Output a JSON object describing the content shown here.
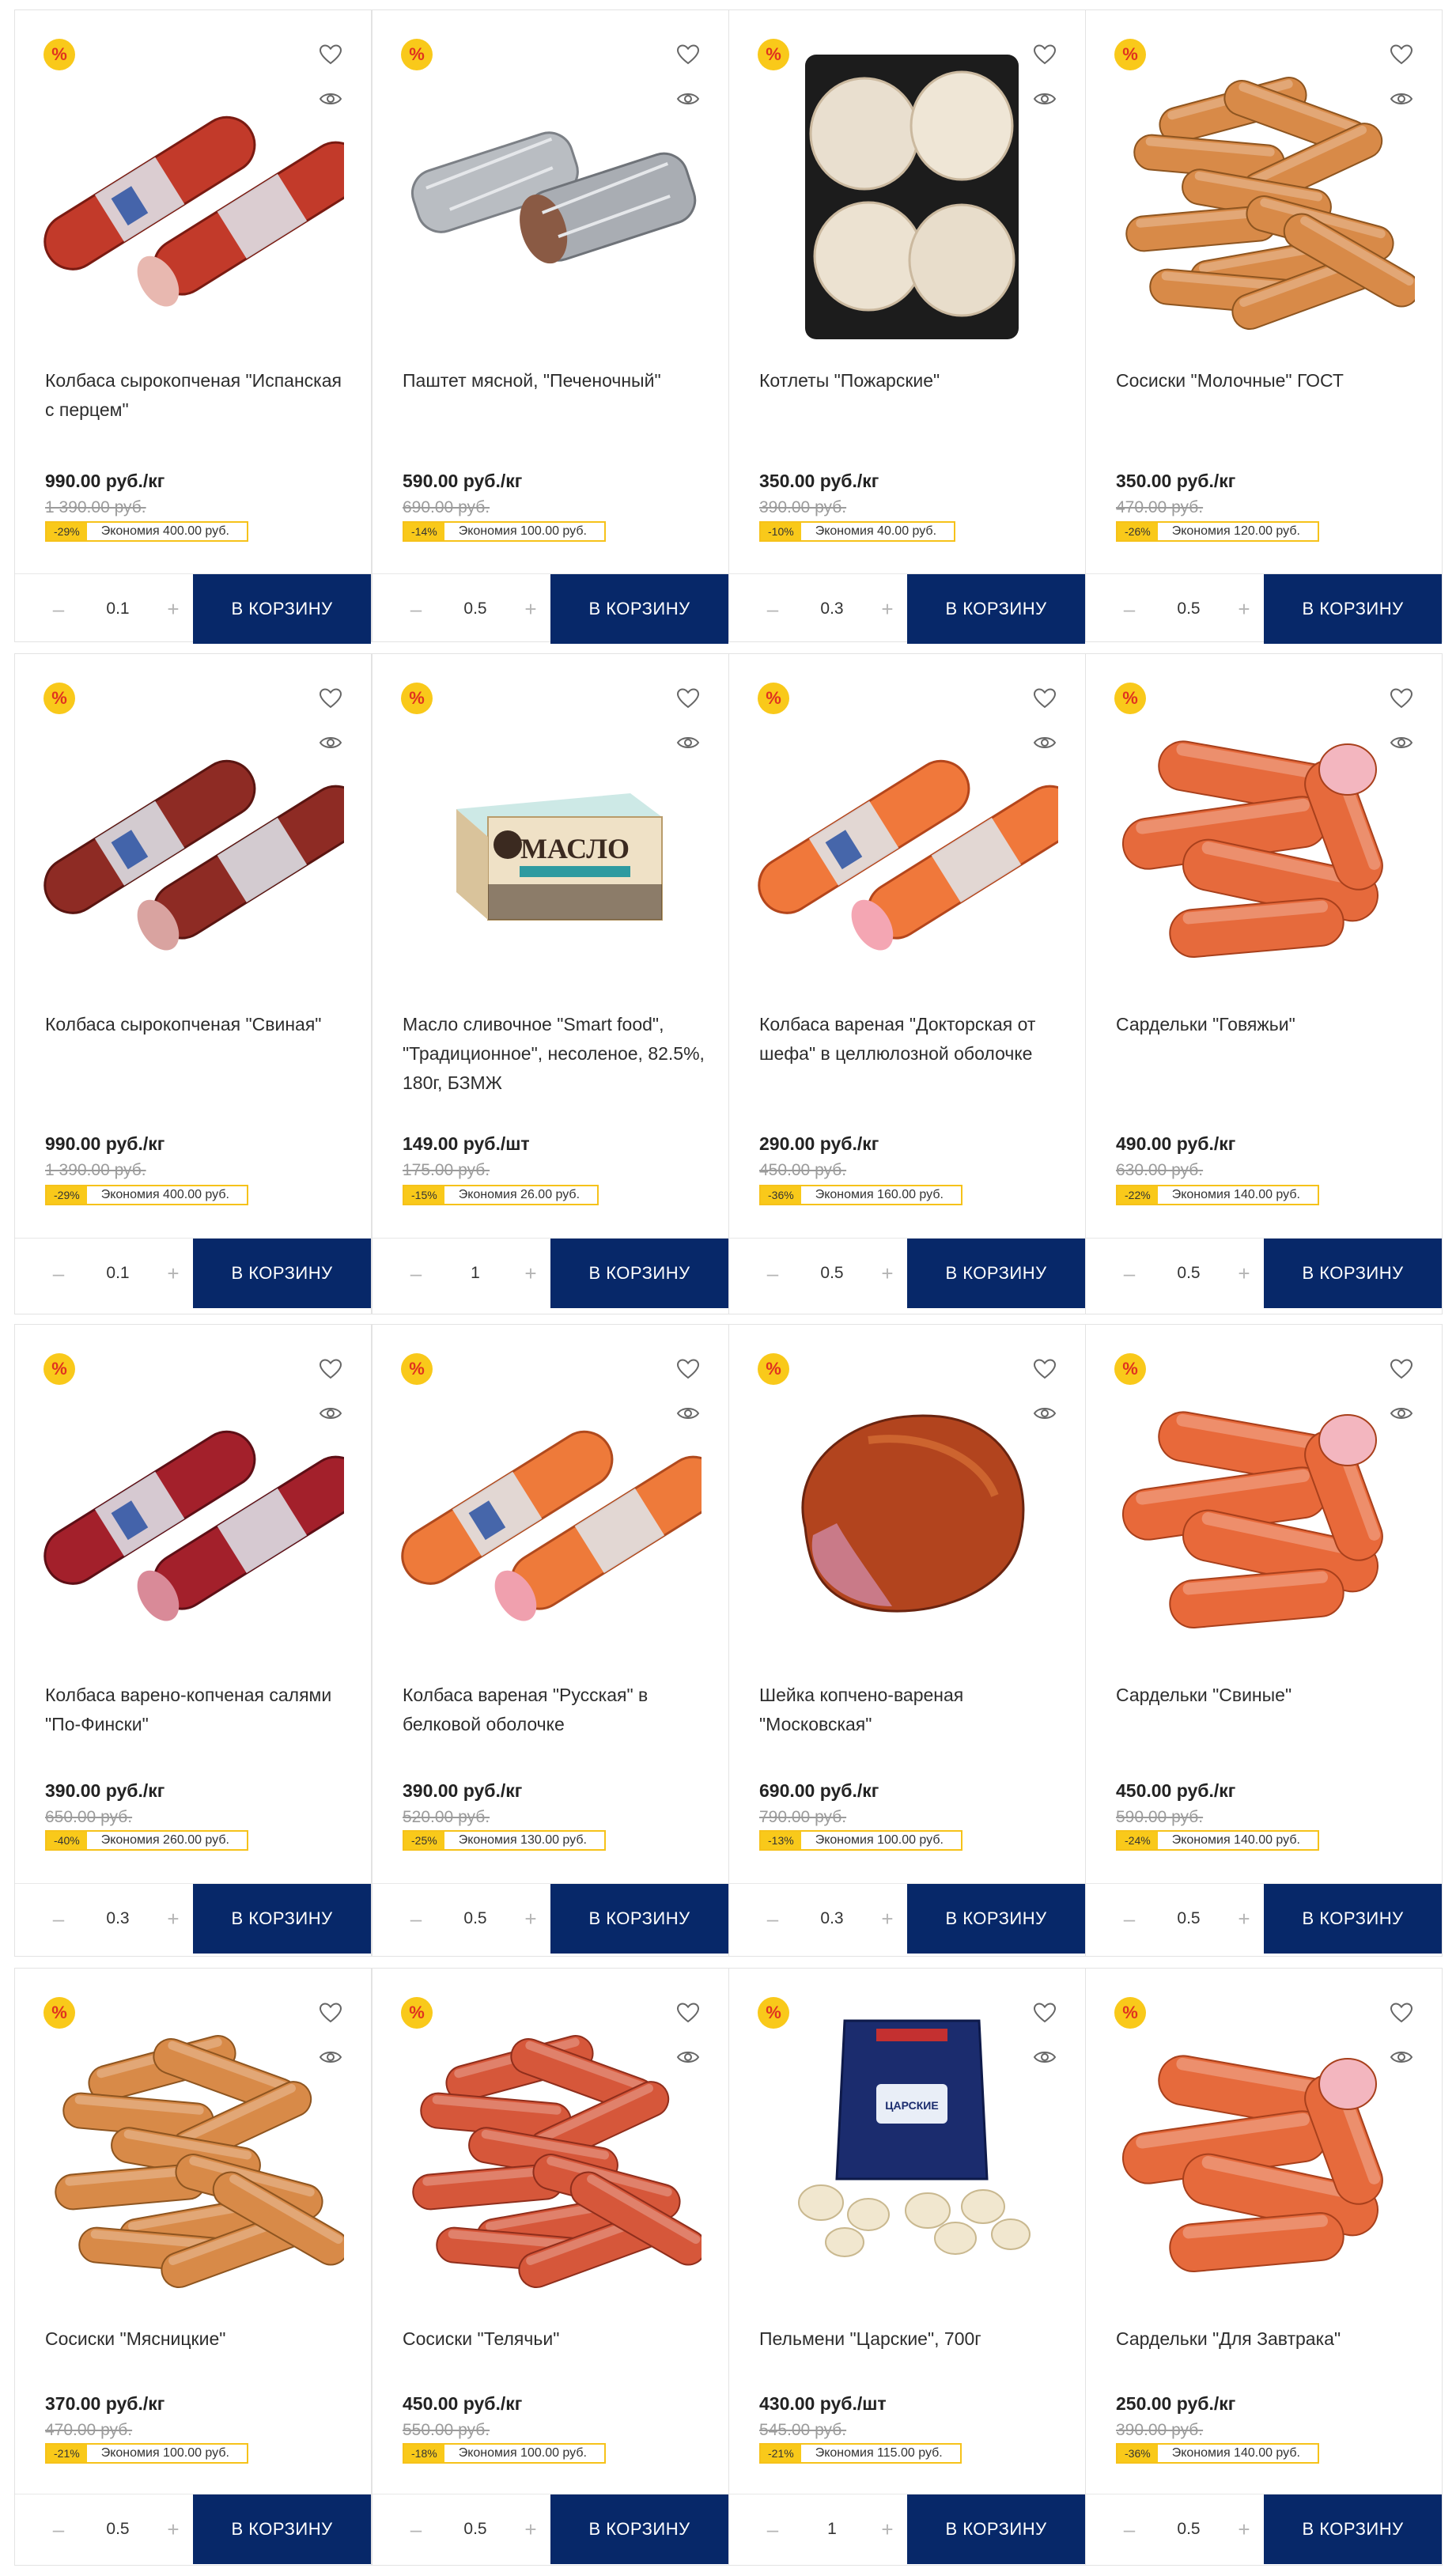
{
  "colors": {
    "accent_navy": "#072869",
    "sale_yellow": "#f9c91a",
    "sale_red": "#e0331f"
  },
  "common": {
    "sale_badge": "%",
    "cart_label": "В КОРЗИНУ",
    "minus": "–",
    "plus": "+"
  },
  "products": [
    {
      "title": "Колбаса сырокопченая \"Испанская с перцем\"",
      "price": "990.00 руб./кг",
      "old_price": "1 390.00 руб.",
      "discount": "-29%",
      "saving": "Экономия 400.00 руб.",
      "qty": "0.1",
      "image": "salami-spanish"
    },
    {
      "title": "Паштет мясной, \"Печеночный\"",
      "price": "590.00 руб./кг",
      "old_price": "690.00 руб.",
      "discount": "-14%",
      "saving": "Экономия 100.00 руб.",
      "qty": "0.5",
      "image": "pate-foil"
    },
    {
      "title": "Котлеты \"Пожарские\"",
      "price": "350.00 руб./кг",
      "old_price": "390.00 руб.",
      "discount": "-10%",
      "saving": "Экономия 40.00 руб.",
      "qty": "0.3",
      "image": "cutlets-tray"
    },
    {
      "title": "Сосиски \"Молочные\" ГОСТ",
      "price": "350.00 руб./кг",
      "old_price": "470.00 руб.",
      "discount": "-26%",
      "saving": "Экономия 120.00 руб.",
      "qty": "0.5",
      "image": "sausages-milk"
    },
    {
      "title": "Колбаса сырокопченая \"Свиная\"",
      "price": "990.00 руб./кг",
      "old_price": "1 390.00 руб.",
      "discount": "-29%",
      "saving": "Экономия 400.00 руб.",
      "qty": "0.1",
      "image": "salami-pork"
    },
    {
      "title": "Масло сливочное \"Smart food\", \"Традиционное\", несоленое, 82.5%, 180г, БЗМЖ",
      "price": "149.00 руб./шт",
      "old_price": "175.00 руб.",
      "discount": "-15%",
      "saving": "Экономия 26.00 руб.",
      "qty": "1",
      "image": "butter-pack"
    },
    {
      "title": "Колбаса вареная \"Докторская от шефа\" в целлюлозной оболочке",
      "price": "290.00 руб./кг",
      "old_price": "450.00 руб.",
      "discount": "-36%",
      "saving": "Экономия 160.00 руб.",
      "qty": "0.5",
      "image": "boiled-doctor"
    },
    {
      "title": "Сардельки \"Говяжьи\"",
      "price": "490.00 руб./кг",
      "old_price": "630.00 руб.",
      "discount": "-22%",
      "saving": "Экономия 140.00 руб.",
      "qty": "0.5",
      "image": "wieners-beef"
    },
    {
      "title": "Колбаса варено-копченая салями \"По-Фински\"",
      "price": "390.00 руб./кг",
      "old_price": "650.00 руб.",
      "discount": "-40%",
      "saving": "Экономия 260.00 руб.",
      "qty": "0.3",
      "image": "salami-finnish"
    },
    {
      "title": "Колбаса вареная \"Русская\" в белковой оболочке",
      "price": "390.00 руб./кг",
      "old_price": "520.00 руб.",
      "discount": "-25%",
      "saving": "Экономия 130.00 руб.",
      "qty": "0.5",
      "image": "boiled-russian"
    },
    {
      "title": "Шейка копчено-вареная \"Московская\"",
      "price": "690.00 руб./кг",
      "old_price": "790.00 руб.",
      "discount": "-13%",
      "saving": "Экономия 100.00 руб.",
      "qty": "0.3",
      "image": "smoked-neck"
    },
    {
      "title": "Сардельки \"Свиные\"",
      "price": "450.00 руб./кг",
      "old_price": "590.00 руб.",
      "discount": "-24%",
      "saving": "Экономия 140.00 руб.",
      "qty": "0.5",
      "image": "wieners-pork"
    },
    {
      "title": "Сосиски \"Мясницкие\"",
      "price": "370.00 руб./кг",
      "old_price": "470.00 руб.",
      "discount": "-21%",
      "saving": "Экономия 100.00 руб.",
      "qty": "0.5",
      "image": "sausages-butcher"
    },
    {
      "title": "Сосиски \"Телячьи\"",
      "price": "450.00 руб./кг",
      "old_price": "550.00 руб.",
      "discount": "-18%",
      "saving": "Экономия 100.00 руб.",
      "qty": "0.5",
      "image": "sausages-veal"
    },
    {
      "title": "Пельмени \"Царские\", 700г",
      "price": "430.00 руб./шт",
      "old_price": "545.00 руб.",
      "discount": "-21%",
      "saving": "Экономия 115.00 руб.",
      "qty": "1",
      "image": "pelmeni-bag"
    },
    {
      "title": "Сардельки \"Для Завтрака\"",
      "price": "250.00 руб./кг",
      "old_price": "390.00 руб.",
      "discount": "-36%",
      "saving": "Экономия 140.00 руб.",
      "qty": "0.5",
      "image": "wieners-breakfast"
    }
  ]
}
